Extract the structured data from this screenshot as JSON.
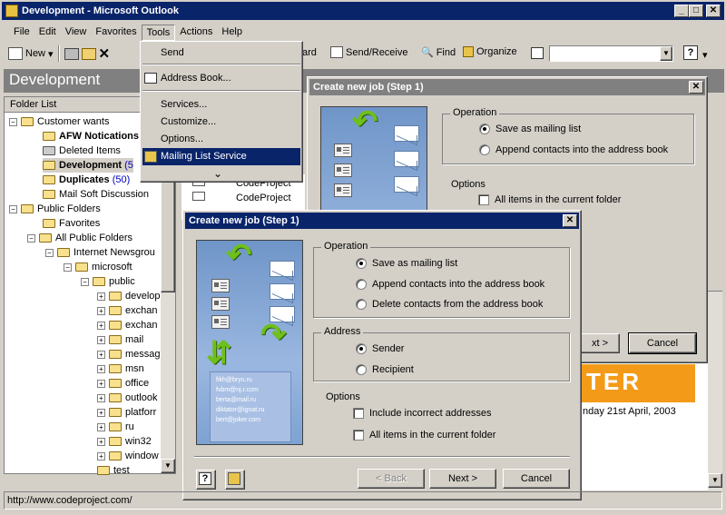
{
  "app": {
    "title": "Development - Microsoft Outlook",
    "min": "_",
    "max": "□",
    "close": "✕"
  },
  "menubar": [
    "File",
    "Edit",
    "View",
    "Favorites",
    "Tools",
    "Actions",
    "Help"
  ],
  "toolbar": {
    "new": "New",
    "send_receive": "Send/Receive",
    "find": "Find",
    "organize": "Organize",
    "help": "?",
    "partial": "ard"
  },
  "folder_header": "Development",
  "folder_list_label": "Folder List",
  "folders": [
    {
      "label": "Customer wants",
      "bold": false
    },
    {
      "label": "AFW Notications",
      "bold": true
    },
    {
      "label": "Deleted Items",
      "bold": false
    },
    {
      "label": "Development",
      "bold": true,
      "count": "(5"
    },
    {
      "label": "Duplicates",
      "bold": true,
      "count": "(50)"
    },
    {
      "label": "Mail Soft Discussion",
      "bold": false
    },
    {
      "label": "Public Folders",
      "bold": false
    },
    {
      "label": "Favorites",
      "bold": false
    },
    {
      "label": "All Public Folders",
      "bold": false
    },
    {
      "label": "Internet Newsgrou",
      "bold": false
    },
    {
      "label": "microsoft",
      "bold": false
    },
    {
      "label": "public",
      "bold": false
    },
    {
      "label": "develop",
      "bold": false
    },
    {
      "label": "exchan",
      "bold": false
    },
    {
      "label": "exchan",
      "bold": false
    },
    {
      "label": "mail",
      "bold": false
    },
    {
      "label": "messag",
      "bold": false
    },
    {
      "label": "msn",
      "bold": false
    },
    {
      "label": "office",
      "bold": false
    },
    {
      "label": "outlook",
      "bold": false
    },
    {
      "label": "platforr",
      "bold": false
    },
    {
      "label": "ru",
      "bold": false
    },
    {
      "label": "win32",
      "bold": false
    },
    {
      "label": "window",
      "bold": false
    },
    {
      "label": "test",
      "bold": false
    }
  ],
  "tools_menu": {
    "items": [
      "Send",
      "Address Book...",
      "Services...",
      "Customize...",
      "Options...",
      "Mailing List Service"
    ],
    "more": "⌄"
  },
  "message_list": [
    "CodeProject",
    "CodeProject"
  ],
  "preview": {
    "banner": "TER",
    "date": "nday 21st April, 2003"
  },
  "dialog_back": {
    "title": "Create new job (Step 1)",
    "operation_label": "Operation",
    "options": [
      "Save as mailing list",
      "Append contacts into the address book"
    ],
    "options_label": "Options",
    "checkbox": "All items in the current folder",
    "next": "xt >",
    "cancel": "Cancel"
  },
  "dialog_front": {
    "title": "Create new job (Step 1)",
    "operation_label": "Operation",
    "operation_options": [
      "Save as mailing list",
      "Append contacts into the  address book",
      "Delete contacts  from the address book"
    ],
    "address_label": "Address",
    "address_options": [
      "Sender",
      "Recipient"
    ],
    "options_label": "Options",
    "checkboxes": [
      "Include incorrect addresses",
      "All items in the current folder"
    ],
    "back": "< Back",
    "next": "Next >",
    "cancel": "Cancel",
    "help": "?",
    "art_emails": [
      "fikh@bryu.ru",
      "fvbm@nj.r.com",
      "berta@mail.ru",
      "diktator@ignat.ru",
      "bert@joker.com"
    ]
  },
  "statusbar": "http://www.codeproject.com/"
}
